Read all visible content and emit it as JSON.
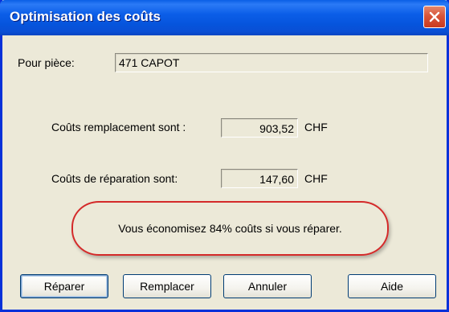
{
  "window": {
    "title": "Optimisation des coûts"
  },
  "part": {
    "label": "Pour pièce:",
    "value": "471 CAPOT"
  },
  "replacement": {
    "label": "Coûts remplacement sont :",
    "value": "903,52",
    "currency": "CHF"
  },
  "repair": {
    "label": "Coûts de réparation sont:",
    "value": "147,60",
    "currency": "CHF"
  },
  "savings_message": "Vous économisez 84% coûts si vous réparer.",
  "buttons": {
    "repair": "Réparer",
    "replace": "Remplacer",
    "cancel": "Annuler",
    "help": "Aide"
  },
  "colors": {
    "titlebar": "#0a5ee6",
    "highlight": "#d42a2a",
    "background": "#ece9d8"
  }
}
